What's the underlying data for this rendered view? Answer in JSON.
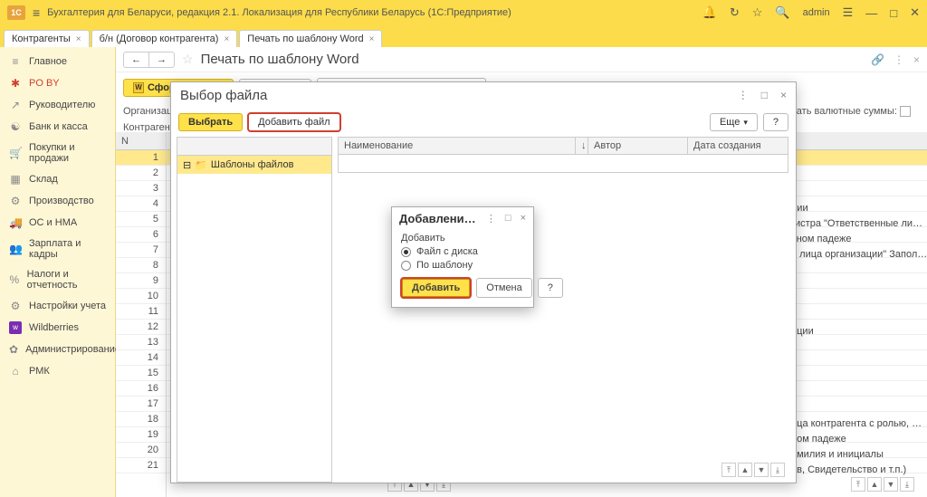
{
  "titlebar": {
    "app_title": "Бухгалтерия для Беларуси, редакция 2.1. Локализация для Республики Беларусь   (1С:Предприятие)",
    "user": "admin"
  },
  "tabs": [
    {
      "label": "Контрагенты"
    },
    {
      "label": "б/н (Договор контрагента)"
    },
    {
      "label": "Печать по шаблону Word"
    }
  ],
  "sidebar": {
    "items": [
      {
        "icon": "≡",
        "label": "Главное"
      },
      {
        "icon": "✱",
        "label": "PO BY"
      },
      {
        "icon": "↗",
        "label": "Руководителю"
      },
      {
        "icon": "☯",
        "label": "Банк и касса"
      },
      {
        "icon": "🛒",
        "label": "Покупки и продажи"
      },
      {
        "icon": "▦",
        "label": "Склад"
      },
      {
        "icon": "⚙",
        "label": "Производство"
      },
      {
        "icon": "🚚",
        "label": "ОС и НМА"
      },
      {
        "icon": "👥",
        "label": "Зарплата и кадры"
      },
      {
        "icon": "%",
        "label": "Налоги и отчетность"
      },
      {
        "icon": "⚙",
        "label": "Настройки учета"
      },
      {
        "icon": "▣",
        "label": "Wildberries"
      },
      {
        "icon": "✿",
        "label": "Администрирование"
      },
      {
        "icon": "⌂",
        "label": "РМК"
      }
    ]
  },
  "page": {
    "title": "Печать по шаблону Word",
    "btn_form": "Сформировать",
    "btn_params": "Параметры",
    "btn_refresh": "Обновить параметры замены",
    "lbl_org": "Организация",
    "lbl_contr": "Контрагент:",
    "col_n": "N",
    "chk_currency": "читывать валютные суммы:"
  },
  "right_texts": [
    "ции",
    "гистра \"Ответственные ли…",
    "ьном падеже",
    "е лица организации\" Запол…",
    "",
    "",
    "",
    "",
    "ации",
    "",
    "",
    "",
    "",
    "",
    "ица контрагента с ролью, …",
    "ном падеже",
    "амилия и инициалы",
    "ав, Свидетельство и т.п.)"
  ],
  "dialog1": {
    "title": "Выбор файла",
    "btn_select": "Выбрать",
    "btn_add_file": "Добавить файл",
    "btn_more": "Еще",
    "tree_root": "Шаблоны файлов",
    "col_name": "Наименование",
    "col_author": "Автор",
    "col_date": "Дата создания"
  },
  "dialog2": {
    "title": "Добавлени…",
    "lbl_add": "Добавить",
    "opt_disk": "Файл с диска",
    "opt_template": "По шаблону",
    "btn_add": "Добавить",
    "btn_cancel": "Отмена"
  }
}
